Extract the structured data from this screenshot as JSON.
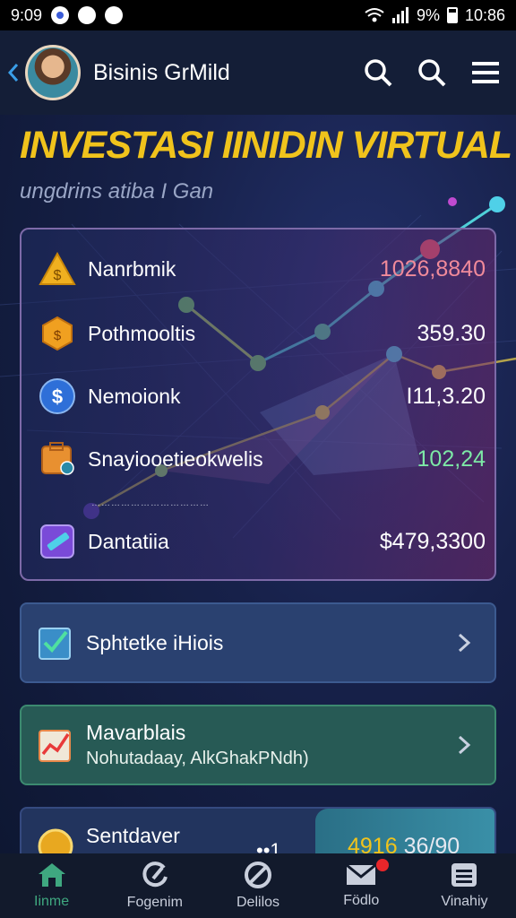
{
  "status_bar": {
    "time": "9:09",
    "battery": "9%",
    "clock": "10:86"
  },
  "header": {
    "title": "Bisinis GrMild"
  },
  "hero": {
    "title": "INVESTASI IINIDIN VIRTUAL",
    "subtitle": "ungdrins atiba I Gan"
  },
  "portfolio": {
    "items": [
      {
        "name": "Nanrbmik",
        "value": "1026,8840",
        "value_color": "#f08a9a",
        "icon": "gold-triangle-icon"
      },
      {
        "name": "Pothmooltis",
        "value": "359.30",
        "value_color": "#ffffff",
        "icon": "orange-hexagon-icon"
      },
      {
        "name": "Nemoionk",
        "value": "I11,3.20",
        "value_color": "#ffffff",
        "icon": "dollar-coin-icon"
      },
      {
        "name": "Snayiooetieokwelis",
        "value": "102,24",
        "value_color": "#7de8a6",
        "icon": "briefcase-icon"
      },
      {
        "name": "Dantatiia",
        "value": "$479,3300",
        "value_color": "#ffffff",
        "icon": "purple-card-icon"
      }
    ],
    "caption": "………………………………"
  },
  "cards": {
    "settings": {
      "title": "Sphtetke iHiois"
    },
    "market": {
      "title": "Mavarblais",
      "subtitle": "Nohutadaay, AlkGhakPNdh)"
    },
    "wallet": {
      "title": "Sentdaver",
      "count": "••1",
      "balance_main": "4916",
      "balance_rest": " 36/90"
    }
  },
  "bottom_nav": [
    {
      "label": "Iinme",
      "icon": "home-icon",
      "active": true
    },
    {
      "label": "Fogenim",
      "icon": "refresh-icon",
      "active": false
    },
    {
      "label": "Delilos",
      "icon": "compass-icon",
      "active": false
    },
    {
      "label": "Födlo",
      "icon": "mail-icon",
      "active": false,
      "badge": true
    },
    {
      "label": "Vinahiy",
      "icon": "list-box-icon",
      "active": false
    }
  ],
  "colors": {
    "accent_yellow": "#f0c31c",
    "accent_green": "#3fa880",
    "badge_red": "#e8262a"
  }
}
